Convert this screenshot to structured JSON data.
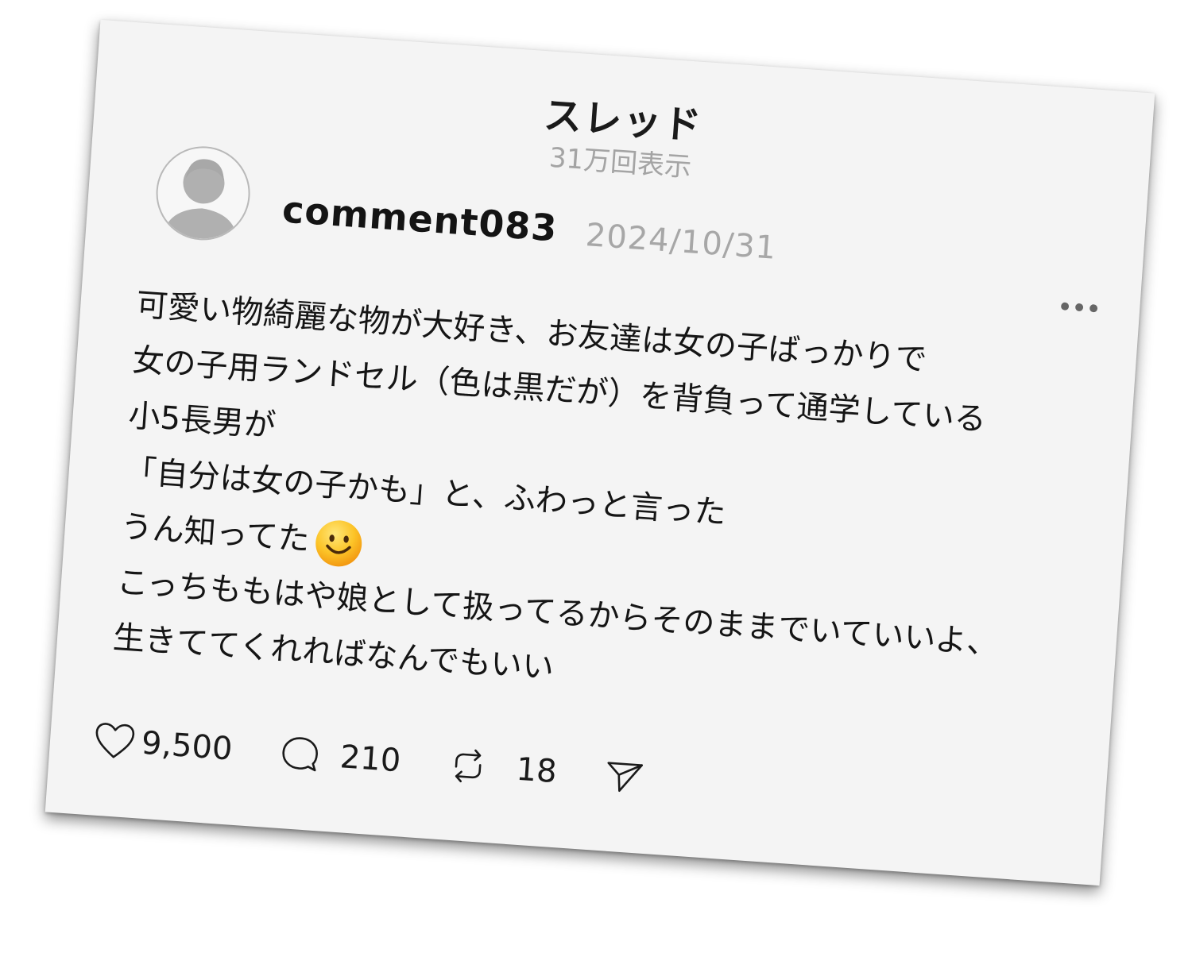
{
  "header": {
    "title": "スレッド",
    "views": "31万回表示"
  },
  "post": {
    "username": "comment083",
    "date": "2024/10/31",
    "more_label": "•••",
    "lines": [
      "可愛い物綺麗な物が大好き、お友達は女の子ばっかりで",
      "女の子用ランドセル（色は黒だが）を背負って通学している",
      "小5長男が",
      "「自分は女の子かも」と、ふわっと言った",
      "うん知ってた",
      "こっちももはや娘として扱ってるからそのままでいていいよ、",
      "生きててくれればなんでもいい"
    ],
    "emoji": "smiling-face-emoji"
  },
  "actions": {
    "likes": "9,500",
    "comments": "210",
    "reposts": "18"
  },
  "icons": {
    "like": "heart-icon",
    "comment": "speech-bubble-icon",
    "repost": "repost-icon",
    "share": "send-icon",
    "avatar": "default-avatar-icon"
  },
  "colors": {
    "card_background": "#f4f4f4",
    "text": "#151515",
    "muted": "#a4a4a4"
  }
}
